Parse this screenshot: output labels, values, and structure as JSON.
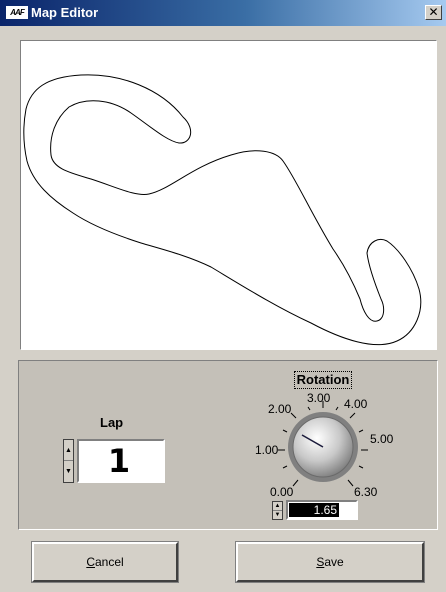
{
  "window": {
    "title": "Map Editor",
    "app_icon_text": "AAF",
    "close_glyph": "✕"
  },
  "map": {
    "background": "#ffffff",
    "track_color": "#000000"
  },
  "lap": {
    "label": "Lap",
    "value": "1"
  },
  "rotation": {
    "label": "Rotation",
    "value": "1.65",
    "min": 0.0,
    "max": 6.3,
    "ticks": [
      "0.00",
      "1.00",
      "2.00",
      "3.00",
      "4.00",
      "5.00",
      "6.30"
    ]
  },
  "buttons": {
    "cancel_mnemonic": "C",
    "cancel_rest": "ancel",
    "save_mnemonic": "S",
    "save_rest": "ave"
  }
}
